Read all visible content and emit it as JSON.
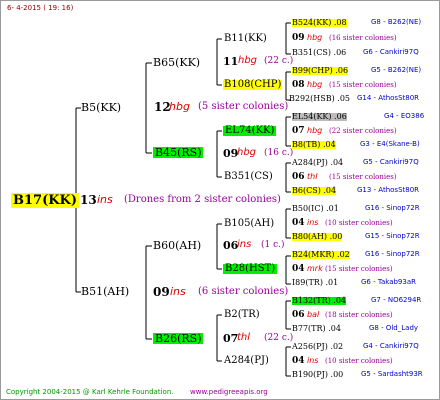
{
  "header": "6- 4-2015 ( 19: 16)",
  "footer_left": "Copyright 2004-2015 @ Karl Kehrle Foundation.",
  "footer_right": "www.pedigreeapis.org",
  "root": {
    "label": "B17(KK)",
    "num": "13",
    "ins": "ins",
    "note": "(Drones from 2 sister colonies)"
  },
  "g1": [
    {
      "label": "B5(KK)",
      "num": "12",
      "ins": "hbg",
      "note": "(5 sister colonies)"
    },
    {
      "label": "B51(AH)",
      "num": "09",
      "ins": "ins",
      "note": "(6 sister colonies)"
    }
  ],
  "g2": [
    {
      "label": "B65(KK)",
      "num": "11",
      "ins": "hbg",
      "note": "(22 c.)"
    },
    {
      "label": "B45(RS)",
      "num": "09",
      "ins": "hbg",
      "note": "(16 c.)"
    },
    {
      "label": "B60(AH)",
      "num": "06",
      "ins": "ins",
      "note": "(1 c.)"
    },
    {
      "label": "B26(RS)",
      "num": "07",
      "ins": "thl",
      "note": "(22 c.)"
    }
  ],
  "g3": [
    {
      "label": "B11(KK)"
    },
    {
      "label": "B108(CHP)"
    },
    {
      "label": "EL74(KK)"
    },
    {
      "label": "B351(CS)"
    },
    {
      "label": "B105(AH)"
    },
    {
      "label": "B28(HST)"
    },
    {
      "label": "B2(TR)"
    },
    {
      "label": "A284(PJ)"
    }
  ],
  "g4": [
    {
      "label": "B524(KK) .08",
      "ref": "G8 - B262(NE)"
    },
    {
      "num": "09",
      "ins": "hbg",
      "note": "(16 sister colonies)"
    },
    {
      "label": "B351(CS) .06",
      "ref": "G6 - Cankiri97Q"
    },
    {
      "label": "B99(CHP) .06",
      "ref": "G5 - B262(NE)"
    },
    {
      "num": "08",
      "ins": "hbg",
      "note": "(15 sister colonies)"
    },
    {
      "label": "B292(HSB) .05",
      "ref": "G14 - AthosSt80R"
    },
    {
      "label": "EL54(KK) .06",
      "ref": "G4 - EO386"
    },
    {
      "num": "07",
      "ins": "hbg",
      "note": "(22 sister colonies)"
    },
    {
      "label": "B8(TB) .04",
      "ref": "G3 - E4(Skane-B)"
    },
    {
      "label": "A284(PJ) .04",
      "ref": "G5 - Cankiri97Q"
    },
    {
      "num": "06",
      "ins": "thl",
      "note": "(15 sister colonies)"
    },
    {
      "label": "B6(CS) .04",
      "ref": "G13 - AthosSt80R"
    },
    {
      "label": "B50(IC) .01",
      "ref": "G16 - Sinop72R"
    },
    {
      "num": "04",
      "ins": "ins",
      "note": "(10 sister colonies)"
    },
    {
      "label": "B80(AH) .00",
      "ref": "G15 - Sinop72R"
    },
    {
      "label": "B24(MKR) .02",
      "ref": "G16 - Sinop72R"
    },
    {
      "num": "04",
      "ins": "mrk",
      "note": "(15 sister colonies)"
    },
    {
      "label": "I89(TR) .01",
      "ref": "G6 - Takab93aR"
    },
    {
      "label": "B132(TR) .04",
      "ref": "G7 - NO6294R"
    },
    {
      "num": "06",
      "ins": "bal",
      "note": "(18 sister colonies)"
    },
    {
      "label": "B77(TR) .04",
      "ref": "G8 - Old_Lady"
    },
    {
      "label": "A256(PJ) .02",
      "ref": "G4 - Cankiri97Q"
    },
    {
      "num": "04",
      "ins": "ins",
      "note": "(10 sister colonies)"
    },
    {
      "label": "B190(PJ) .00",
      "ref": "G5 - Sardasht93R"
    }
  ]
}
